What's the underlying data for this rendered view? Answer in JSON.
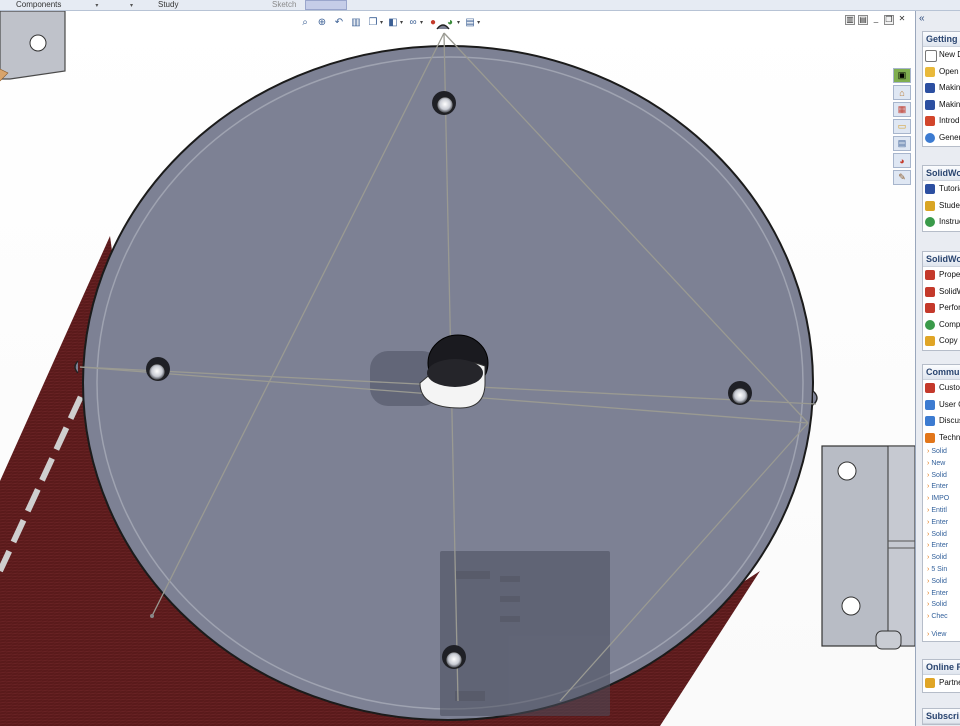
{
  "toolbar_tabs": [
    {
      "label": "Components",
      "dropdown": true
    },
    {
      "label": "",
      "dropdown": true
    },
    {
      "label": "Study",
      "dropdown": false
    },
    {
      "label": "Sketch",
      "dropdown": false
    }
  ],
  "view_toolbar": {
    "icons": [
      "zoom-to-fit-icon",
      "zoom-to-area-icon",
      "previous-view-icon",
      "section-view-icon",
      "view-orientation-icon",
      "display-style-icon",
      "hide-show-items-icon",
      "edit-appearance-icon",
      "apply-scene-icon",
      "view-settings-icon"
    ]
  },
  "window_controls": [
    "tile-horizontal-icon",
    "tile-vertical-icon",
    "minimize-icon",
    "restore-icon",
    "close-icon"
  ],
  "task_pane_tabs": [
    "solidworks-resources-icon",
    "design-library-icon",
    "file-explorer-icon",
    "search-icon",
    "view-palette-icon",
    "appearances-icon",
    "custom-properties-icon"
  ],
  "panel": {
    "collapse_glyph": "«",
    "sections": [
      {
        "title": "Getting",
        "items": [
          {
            "label": "New D",
            "icon_color": "#ffffff"
          },
          {
            "label": "Open",
            "icon_color": "#e9b93a"
          },
          {
            "label": "Making",
            "icon_color": "#2c4fa1"
          },
          {
            "label": "Making",
            "icon_color": "#2c4fa1"
          },
          {
            "label": "Introdu",
            "icon_color": "#d2452b"
          },
          {
            "label": "Genera",
            "icon_color": "#3c7bd1"
          }
        ]
      },
      {
        "title": "SolidWo",
        "items": [
          {
            "label": "Tutoria",
            "icon_color": "#2c4fa1"
          },
          {
            "label": "Studer",
            "icon_color": "#d9a524"
          },
          {
            "label": "Instruc",
            "icon_color": "#3a9a4a"
          }
        ]
      },
      {
        "title": "SolidWo",
        "items": [
          {
            "label": "Proper",
            "icon_color": "#c4392b"
          },
          {
            "label": "SolidW",
            "icon_color": "#c4392b"
          },
          {
            "label": "Perfor",
            "icon_color": "#c4392b"
          },
          {
            "label": "Compa",
            "icon_color": "#3a9a4a"
          },
          {
            "label": "Copy",
            "icon_color": "#e0a526"
          }
        ]
      },
      {
        "title": "Commu",
        "items": [
          {
            "label": "Custo",
            "icon_color": "#c4392b"
          },
          {
            "label": "User G",
            "icon_color": "#3c7bd1"
          },
          {
            "label": "Discus",
            "icon_color": "#3c7bd1"
          },
          {
            "label": "Techn",
            "icon_color": "#e2761a"
          }
        ],
        "subitems": [
          "Solid",
          "New",
          "Solid",
          "Enter",
          "IMPO",
          "Entitl",
          "Enter",
          "Solid",
          "Enter",
          "Solid",
          "5 Sin",
          "Solid",
          "Enter",
          "Solid",
          "Chec",
          "View"
        ]
      },
      {
        "title": "Online F",
        "items": [
          {
            "label": "Partne",
            "icon_color": "#e0a526"
          }
        ]
      },
      {
        "title": "Subscri",
        "items": []
      }
    ]
  },
  "colors": {
    "disc": "#7d8194",
    "disc_rim": "#a8acb9",
    "wood": "#5a1a1b",
    "bracket": "#b8bcc5",
    "panel_bg": "#e9ecf2",
    "accent": "#2a4570"
  }
}
